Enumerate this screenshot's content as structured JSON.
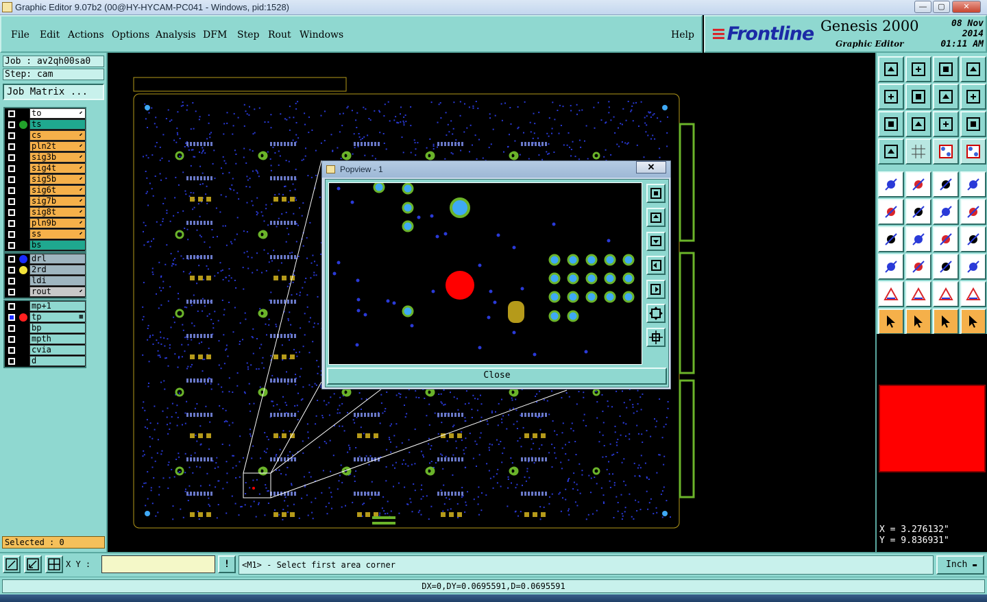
{
  "window": {
    "title": "Graphic Editor 9.07b2 (00@HY-HYCAM-PC041 - Windows, pid:1528)",
    "buttons": [
      "—",
      "▢",
      "✕"
    ]
  },
  "menu": {
    "items": [
      "File",
      "Edit",
      "Actions",
      "Options",
      "Analysis",
      "DFM",
      "Step",
      "Rout",
      "Windows"
    ],
    "help": "Help"
  },
  "brand": {
    "logo": "Frontline",
    "product": "Genesis 2000",
    "subtitle": "Graphic Editor",
    "date": "08 Nov 2014",
    "time": "01:11 AM"
  },
  "job": {
    "job_line": "Job : av2qh00sa0",
    "step_line": "Step: cam",
    "matrix_button": "Job Matrix ..."
  },
  "layers": {
    "group1": [
      {
        "name": "to",
        "color": "#ffffff",
        "dot": "",
        "mark": "⬋"
      },
      {
        "name": "ts",
        "color": "#1fa88f",
        "dot": "#22a02a",
        "mark": ""
      },
      {
        "name": "cs",
        "color": "#f5b04a",
        "dot": "",
        "mark": "⬋"
      },
      {
        "name": "pln2t",
        "color": "#f5b04a",
        "dot": "",
        "mark": "⬋"
      },
      {
        "name": "sig3b",
        "color": "#f5b04a",
        "dot": "",
        "mark": "⬋"
      },
      {
        "name": "sig4t",
        "color": "#f5b04a",
        "dot": "",
        "mark": "⬋"
      },
      {
        "name": "sig5b",
        "color": "#f5b04a",
        "dot": "",
        "mark": "⬋"
      },
      {
        "name": "sig6t",
        "color": "#f5b04a",
        "dot": "",
        "mark": "⬋"
      },
      {
        "name": "sig7b",
        "color": "#f5b04a",
        "dot": "",
        "mark": "⬋"
      },
      {
        "name": "sig8t",
        "color": "#f5b04a",
        "dot": "",
        "mark": "⬋"
      },
      {
        "name": "pln9b",
        "color": "#f5b04a",
        "dot": "",
        "mark": "⬋"
      },
      {
        "name": "ss",
        "color": "#f5b04a",
        "dot": "",
        "mark": "⬋"
      },
      {
        "name": "bs",
        "color": "#1fa88f",
        "dot": "",
        "mark": ""
      }
    ],
    "group2": [
      {
        "name": "drl",
        "color": "#9fb6c0",
        "dot": "#1a2cff",
        "mark": ""
      },
      {
        "name": "2rd",
        "color": "#9fb6c0",
        "dot": "#f2e23a",
        "mark": ""
      },
      {
        "name": "ldi",
        "color": "#9fb6c0",
        "dot": "",
        "mark": ""
      },
      {
        "name": "rout",
        "color": "#c8c8c8",
        "dot": "",
        "mark": "⬋"
      }
    ],
    "group3": [
      {
        "name": "mp+1",
        "color": "#8fd8d0",
        "dot": "",
        "mark": ""
      },
      {
        "name": "tp",
        "color": "#8fd8d0",
        "dot": "#ff2020",
        "mark": "▦"
      },
      {
        "name": "bp",
        "color": "#8fd8d0",
        "dot": "",
        "mark": ""
      },
      {
        "name": "mpth",
        "color": "#8fd8d0",
        "dot": "",
        "mark": ""
      },
      {
        "name": "cvia",
        "color": "#8fd8d0",
        "dot": "",
        "mark": ""
      },
      {
        "name": "d",
        "color": "#8fd8d0",
        "dot": "",
        "mark": ""
      }
    ]
  },
  "selected": "Selected : 0",
  "popview": {
    "title": "Popview - 1",
    "close_x": "✕",
    "close_button": "Close"
  },
  "right_tools": [
    "zoom-home-icon",
    "zoom-page-icon",
    "home-window-icon",
    "window-split-icon",
    "pan-left-icon",
    "pan-right-icon",
    "mirror-icon",
    "swap-icon",
    "fit-icon",
    "center-icon",
    "scale-1-2-icon",
    "help-query-icon",
    "filter-icon",
    "grid-icon",
    "snap-a-icon",
    "snap-b-icon",
    "select-pad-icon",
    "draw-line-icon",
    "ruler-icon",
    "pad-icon",
    "connect-icon",
    "cross-icon",
    "move-icon",
    "route-icon",
    "angle-icon",
    "slope-icon",
    "rotate-icon",
    "flip-icon",
    "step-icon",
    "line-width-icon",
    "measure-icon",
    "copy-icon",
    "triangle-a-icon",
    "triangle-b-icon",
    "triangle-c-icon",
    "triangle-d-icon",
    "pointer-icon",
    "select-box-icon",
    "select-arrow-icon",
    "select-multi-icon"
  ],
  "coords": {
    "x": "X = 3.276132\"",
    "y": "Y = 9.836931\""
  },
  "status": {
    "xy_label": "X Y :",
    "xy_value": "",
    "alert": "!",
    "prompt": "<M1> - Select first area corner",
    "unit": "Inch",
    "delta": "DX=0,DY=0.0695591,D=0.0695591"
  },
  "colors": {
    "panel": "#8fd8d0",
    "canvas": "#000000",
    "pad_green": "#6bb42a",
    "via_blue": "#2a3ad8",
    "smd_gold": "#b59a1a",
    "highlight_red": "#ff0000"
  }
}
